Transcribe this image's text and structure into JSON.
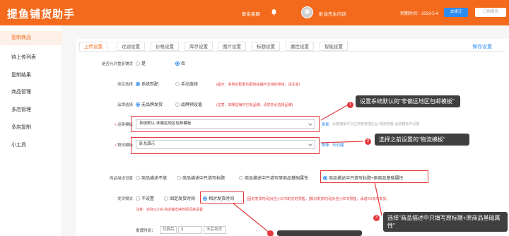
{
  "header": {
    "brand": "提鱼铺货助手",
    "service": "联系客服",
    "shop": "卧龙先生的店",
    "expire": "到期时间：2023-5-4",
    "renew": "去续订",
    "order": "订购服务"
  },
  "sidebar": {
    "items": [
      {
        "label": "复制商品"
      },
      {
        "label": "待上传列表"
      },
      {
        "label": "复制结果"
      },
      {
        "label": "商品管理"
      },
      {
        "label": "多店管理"
      },
      {
        "label": "多店复制"
      },
      {
        "label": "小工具"
      }
    ]
  },
  "tabs": [
    {
      "label": "上传设置"
    },
    {
      "label": "过滤设置"
    },
    {
      "label": "价格设置"
    },
    {
      "label": "库存设置"
    },
    {
      "label": "图片设置"
    },
    {
      "label": "标题设置"
    },
    {
      "label": "属性设置"
    },
    {
      "label": "智能设置"
    }
  ],
  "save_label": "保存设置",
  "form": {
    "dup_label": "是否允许重复铺货",
    "dup_yes": "是",
    "dup_no": "否",
    "cat_label": "类目选择",
    "cat_opt1": "系统匹配",
    "cat_opt2": "手动选择",
    "cat_hint": "(提示：系统匹配若匹配到店铺不支持的类目，请注意)",
    "brand_label": "品牌选择",
    "brand_opt1": "无品牌发货",
    "brand_opt2": "品牌预设值",
    "brand_hint": "(注意：如果店铺中已有品牌，请您务必选择品牌)",
    "freight_label": "运费模板",
    "freight_value": "系统默认-非偏远地区包邮模板",
    "freight_refresh": "刷新",
    "freight_hint": "设置模板可以在商家管理后台-物流管理-运费模板中设置",
    "logistics_label": "物流模板",
    "logistics_value": "卧龙演示",
    "logistics_refresh": "刷新",
    "logistics_create": "去创建",
    "desc_label": "商品描述设置",
    "desc_opt1": "商品描述不填",
    "desc_opt2": "商品描述中只填写标题",
    "desc_opt3": "商品描述中只填写原商品基础属性",
    "desc_opt4": "商品描述中只填写标题+原商品基础属性",
    "ship_label": "发货模式",
    "ship_opt1": "不设置",
    "ship_opt2": "固定发货时间",
    "ship_opt3": "相对发货时间",
    "ship_hint": "[固定发货时间]对应小红书的定时预售，[相对发货时间]对应小红书预售，承诺XX天内发货。",
    "ship_note": "注意：实际以小红书店铺支持的情况来设置",
    "ship_time_label": "发货时间：",
    "ship_time_prefix": "付款后",
    "ship_time_value": "3",
    "ship_time_suffix": "天后发货"
  },
  "callouts": [
    {
      "num": "1",
      "text": "设置系统默认的\"非偏远地区包邮模板\""
    },
    {
      "num": "2",
      "text": "选择之前设置的\"物流模板\""
    },
    {
      "num": "3",
      "text": "选择\"商品描述中只填写原标题+原商品基础属性\""
    }
  ]
}
